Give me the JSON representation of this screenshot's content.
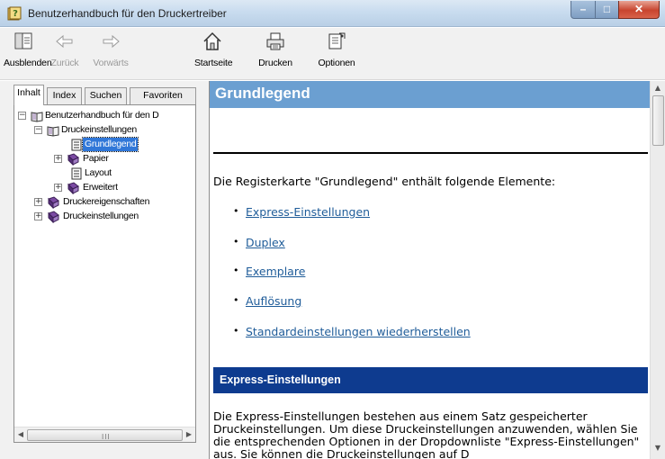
{
  "window": {
    "title": "Benutzerhandbuch für den Druckertreiber",
    "controls": {
      "minimize": "–",
      "maximize": "□",
      "close": "✕"
    }
  },
  "toolbar": {
    "buttons": [
      {
        "label": "Ausblenden",
        "icon": "hide-pane-icon",
        "enabled": true
      },
      {
        "label": "Zurück",
        "icon": "back-arrow-icon",
        "enabled": false
      },
      {
        "label": "Vorwärts",
        "icon": "forward-arrow-icon",
        "enabled": false
      },
      {
        "label": "Startseite",
        "icon": "home-icon",
        "enabled": true
      },
      {
        "label": "Drucken",
        "icon": "printer-icon",
        "enabled": true
      },
      {
        "label": "Optionen",
        "icon": "options-icon",
        "enabled": true
      }
    ]
  },
  "navigation": {
    "tabs": [
      {
        "label": "Inhalt",
        "active": true
      },
      {
        "label": "Index",
        "active": false
      },
      {
        "label": "Suchen",
        "active": false
      },
      {
        "label": "Favoriten",
        "active": false
      }
    ],
    "tree": [
      {
        "label": "Benutzerhandbuch für den D",
        "expander": "minus",
        "icon": "open-book-icon"
      },
      {
        "label": "Druckeinstellungen",
        "expander": "minus",
        "icon": "open-book-icon"
      },
      {
        "label": "Grundlegend",
        "expander": "",
        "icon": "page-icon",
        "selected": true
      },
      {
        "label": "Papier",
        "expander": "plus",
        "icon": "closed-book-icon"
      },
      {
        "label": "Layout",
        "expander": "",
        "icon": "page-icon"
      },
      {
        "label": "Erweitert",
        "expander": "plus",
        "icon": "closed-book-icon"
      },
      {
        "label": "Druckereigenschaften",
        "expander": "plus",
        "icon": "closed-book-icon"
      },
      {
        "label": "Druckeinstellungen",
        "expander": "plus",
        "icon": "closed-book-icon"
      }
    ],
    "scrollbar": {
      "left_arrow": "◀",
      "right_arrow": "▶",
      "grip": "III"
    }
  },
  "content": {
    "heading": "Grundlegend",
    "intro": "Die Registerkarte \"Grundlegend\" enthält folgende Elemente:",
    "bullet": "•",
    "links": [
      "Express-Einstellungen",
      "Duplex",
      "Exemplare",
      "Auflösung",
      "Standardeinstellungen wiederherstellen"
    ],
    "section_heading": "Express-Einstellungen",
    "paragraph": "Die Express-Einstellungen bestehen aus einem Satz gespeicherter Druckeinstellungen. Um diese Druckeinstellungen anzuwenden, wählen Sie die entsprechenden Optionen in der Dropdownliste \"Express-Einstellungen\" aus. Sie können die Druckeinstellungen auf D",
    "scrollbar": {
      "up_arrow": "▲",
      "down_arrow": "▼"
    }
  },
  "colors": {
    "heading_bar": "#6b9fd1",
    "section_bar": "#0e3b8f",
    "link": "#1f5c99",
    "selection": "#3077d8"
  }
}
